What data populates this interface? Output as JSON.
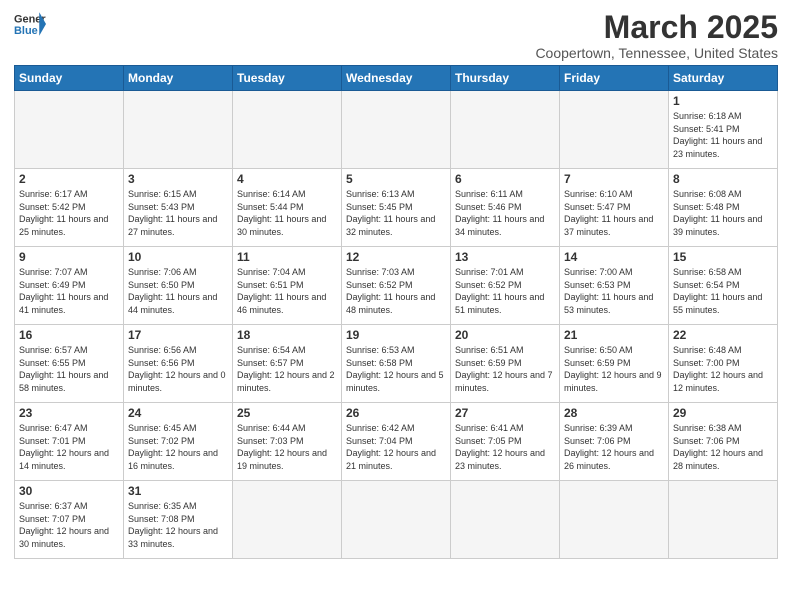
{
  "header": {
    "logo_general": "General",
    "logo_blue": "Blue",
    "title": "March 2025",
    "subtitle": "Coopertown, Tennessee, United States"
  },
  "days_of_week": [
    "Sunday",
    "Monday",
    "Tuesday",
    "Wednesday",
    "Thursday",
    "Friday",
    "Saturday"
  ],
  "weeks": [
    [
      {
        "day": "",
        "empty": true
      },
      {
        "day": "",
        "empty": true
      },
      {
        "day": "",
        "empty": true
      },
      {
        "day": "",
        "empty": true
      },
      {
        "day": "",
        "empty": true
      },
      {
        "day": "",
        "empty": true
      },
      {
        "day": "1",
        "sunrise": "6:18 AM",
        "sunset": "5:41 PM",
        "daylight": "11 hours and 23 minutes."
      }
    ],
    [
      {
        "day": "2",
        "sunrise": "6:17 AM",
        "sunset": "5:42 PM",
        "daylight": "11 hours and 25 minutes."
      },
      {
        "day": "3",
        "sunrise": "6:15 AM",
        "sunset": "5:43 PM",
        "daylight": "11 hours and 27 minutes."
      },
      {
        "day": "4",
        "sunrise": "6:14 AM",
        "sunset": "5:44 PM",
        "daylight": "11 hours and 30 minutes."
      },
      {
        "day": "5",
        "sunrise": "6:13 AM",
        "sunset": "5:45 PM",
        "daylight": "11 hours and 32 minutes."
      },
      {
        "day": "6",
        "sunrise": "6:11 AM",
        "sunset": "5:46 PM",
        "daylight": "11 hours and 34 minutes."
      },
      {
        "day": "7",
        "sunrise": "6:10 AM",
        "sunset": "5:47 PM",
        "daylight": "11 hours and 37 minutes."
      },
      {
        "day": "8",
        "sunrise": "6:08 AM",
        "sunset": "5:48 PM",
        "daylight": "11 hours and 39 minutes."
      }
    ],
    [
      {
        "day": "9",
        "sunrise": "7:07 AM",
        "sunset": "6:49 PM",
        "daylight": "11 hours and 41 minutes."
      },
      {
        "day": "10",
        "sunrise": "7:06 AM",
        "sunset": "6:50 PM",
        "daylight": "11 hours and 44 minutes."
      },
      {
        "day": "11",
        "sunrise": "7:04 AM",
        "sunset": "6:51 PM",
        "daylight": "11 hours and 46 minutes."
      },
      {
        "day": "12",
        "sunrise": "7:03 AM",
        "sunset": "6:52 PM",
        "daylight": "11 hours and 48 minutes."
      },
      {
        "day": "13",
        "sunrise": "7:01 AM",
        "sunset": "6:52 PM",
        "daylight": "11 hours and 51 minutes."
      },
      {
        "day": "14",
        "sunrise": "7:00 AM",
        "sunset": "6:53 PM",
        "daylight": "11 hours and 53 minutes."
      },
      {
        "day": "15",
        "sunrise": "6:58 AM",
        "sunset": "6:54 PM",
        "daylight": "11 hours and 55 minutes."
      }
    ],
    [
      {
        "day": "16",
        "sunrise": "6:57 AM",
        "sunset": "6:55 PM",
        "daylight": "11 hours and 58 minutes."
      },
      {
        "day": "17",
        "sunrise": "6:56 AM",
        "sunset": "6:56 PM",
        "daylight": "12 hours and 0 minutes."
      },
      {
        "day": "18",
        "sunrise": "6:54 AM",
        "sunset": "6:57 PM",
        "daylight": "12 hours and 2 minutes."
      },
      {
        "day": "19",
        "sunrise": "6:53 AM",
        "sunset": "6:58 PM",
        "daylight": "12 hours and 5 minutes."
      },
      {
        "day": "20",
        "sunrise": "6:51 AM",
        "sunset": "6:59 PM",
        "daylight": "12 hours and 7 minutes."
      },
      {
        "day": "21",
        "sunrise": "6:50 AM",
        "sunset": "6:59 PM",
        "daylight": "12 hours and 9 minutes."
      },
      {
        "day": "22",
        "sunrise": "6:48 AM",
        "sunset": "7:00 PM",
        "daylight": "12 hours and 12 minutes."
      }
    ],
    [
      {
        "day": "23",
        "sunrise": "6:47 AM",
        "sunset": "7:01 PM",
        "daylight": "12 hours and 14 minutes."
      },
      {
        "day": "24",
        "sunrise": "6:45 AM",
        "sunset": "7:02 PM",
        "daylight": "12 hours and 16 minutes."
      },
      {
        "day": "25",
        "sunrise": "6:44 AM",
        "sunset": "7:03 PM",
        "daylight": "12 hours and 19 minutes."
      },
      {
        "day": "26",
        "sunrise": "6:42 AM",
        "sunset": "7:04 PM",
        "daylight": "12 hours and 21 minutes."
      },
      {
        "day": "27",
        "sunrise": "6:41 AM",
        "sunset": "7:05 PM",
        "daylight": "12 hours and 23 minutes."
      },
      {
        "day": "28",
        "sunrise": "6:39 AM",
        "sunset": "7:06 PM",
        "daylight": "12 hours and 26 minutes."
      },
      {
        "day": "29",
        "sunrise": "6:38 AM",
        "sunset": "7:06 PM",
        "daylight": "12 hours and 28 minutes."
      }
    ],
    [
      {
        "day": "30",
        "sunrise": "6:37 AM",
        "sunset": "7:07 PM",
        "daylight": "12 hours and 30 minutes."
      },
      {
        "day": "31",
        "sunrise": "6:35 AM",
        "sunset": "7:08 PM",
        "daylight": "12 hours and 33 minutes."
      },
      {
        "day": "",
        "empty": true
      },
      {
        "day": "",
        "empty": true
      },
      {
        "day": "",
        "empty": true
      },
      {
        "day": "",
        "empty": true
      },
      {
        "day": "",
        "empty": true
      }
    ]
  ]
}
